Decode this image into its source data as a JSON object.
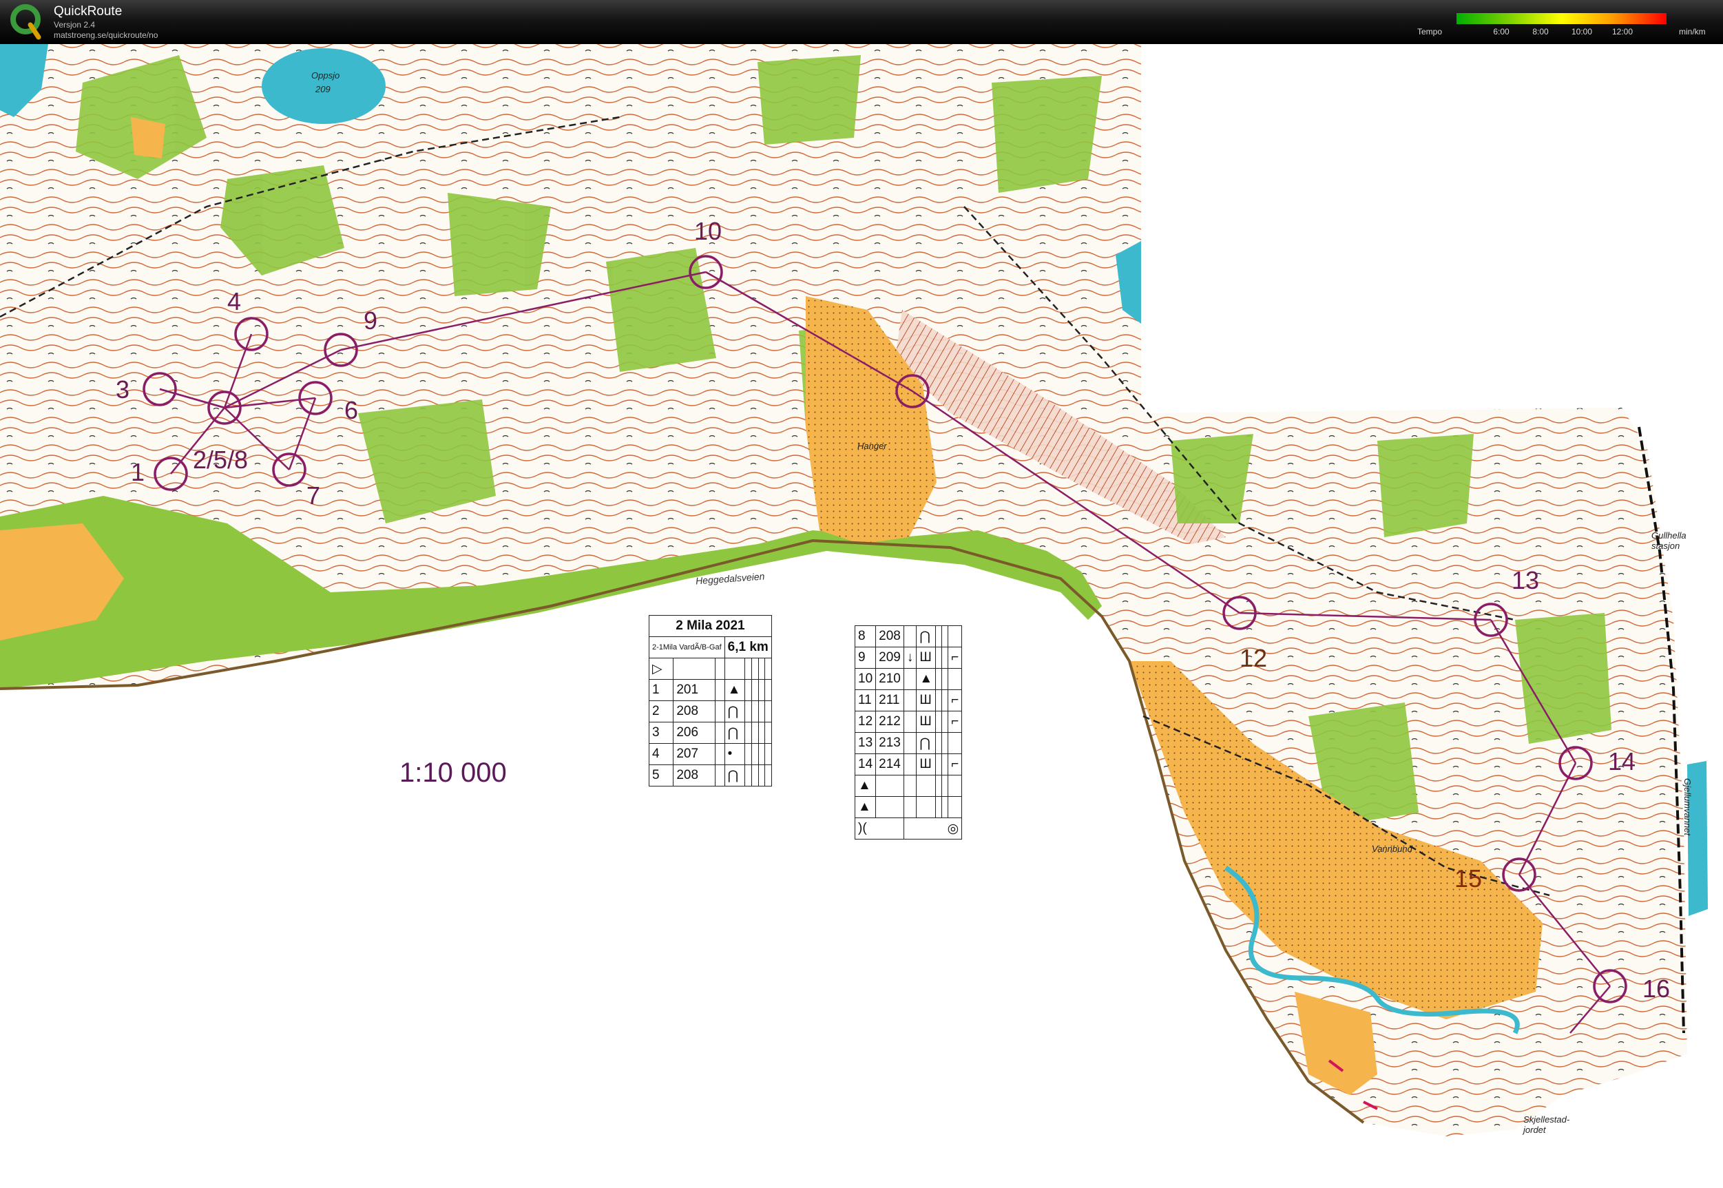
{
  "app": {
    "title": "QuickRoute",
    "version": "Versjon 2.4",
    "url": "matstroeng.se/quickroute/no"
  },
  "tempo_legend": {
    "label": "Tempo",
    "ticks": [
      "6:00",
      "8:00",
      "10:00",
      "12:00"
    ],
    "unit": "min/km"
  },
  "map": {
    "scale": "1:10 000",
    "controls": [
      "1",
      "2/5/8",
      "3",
      "4",
      "6",
      "7",
      "9",
      "10",
      "12",
      "13",
      "14",
      "15",
      "16"
    ],
    "place_names": {
      "lake": "Oppsjo",
      "lake_height": "209",
      "field": "Hanger",
      "road": "Heggedalsveien",
      "station": "Gullhella stasjon",
      "field2": "Skjellestad-jordet",
      "lake2": "Gjellumvannet",
      "field3": "Vannbund"
    },
    "colors": {
      "course": "#8a1e66",
      "open_land": "#f7b54a",
      "vegetation": "#8ec63f",
      "water": "#3cb9cc",
      "contour": "#c8572a"
    }
  },
  "description_sheet": {
    "event": "2 Mila 2021",
    "class": "2-1Mila VardÃ/B-Gaf",
    "distance": "6,1 km",
    "left_rows": [
      {
        "num": "1",
        "code": "201",
        "sym": "▲"
      },
      {
        "num": "2",
        "code": "208",
        "sym": "⋂"
      },
      {
        "num": "3",
        "code": "206",
        "sym": "⋂"
      },
      {
        "num": "4",
        "code": "207",
        "sym": "•"
      },
      {
        "num": "5",
        "code": "208",
        "sym": "⋂"
      }
    ],
    "right_rows": [
      {
        "num": "8",
        "code": "208",
        "sym": "⋂"
      },
      {
        "num": "9",
        "code": "209",
        "sym": "Ш"
      },
      {
        "num": "10",
        "code": "210",
        "sym": "▲"
      },
      {
        "num": "11",
        "code": "211",
        "sym": "Ш"
      },
      {
        "num": "12",
        "code": "212",
        "sym": "Ш"
      },
      {
        "num": "13",
        "code": "213",
        "sym": "⋂"
      },
      {
        "num": "14",
        "code": "214",
        "sym": "Ш"
      }
    ]
  }
}
